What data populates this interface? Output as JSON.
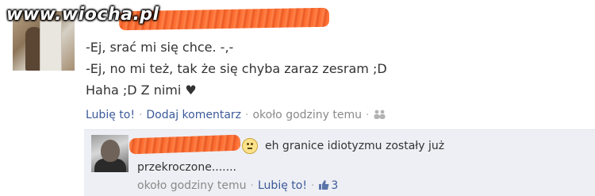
{
  "watermark": "www.wiocha.pl",
  "post": {
    "lines": [
      "-Ej, srać mi się chce. -,-",
      "-Ej, no mi też, tak że się chyba zaraz zesram ;D",
      "Haha ;D Z nimi ♥"
    ],
    "actions": {
      "like": "Lubię to!",
      "comment": "Dodaj komentarz",
      "time": "około godziny temu"
    }
  },
  "comment": {
    "text_line1": "eh granice idiotyzmu zostały już",
    "text_line2": "przekroczone.......",
    "time": "około godziny temu",
    "like": "Lubię to!",
    "like_count": "3"
  },
  "icons": {
    "audience": "people-icon",
    "like": "thumbs-up-icon",
    "emoticon": "smiley-icon"
  },
  "colors": {
    "link": "#3b5998",
    "meta": "#8a8a8a",
    "comment_bg": "#edeff4",
    "censor": "#ff5e19"
  }
}
